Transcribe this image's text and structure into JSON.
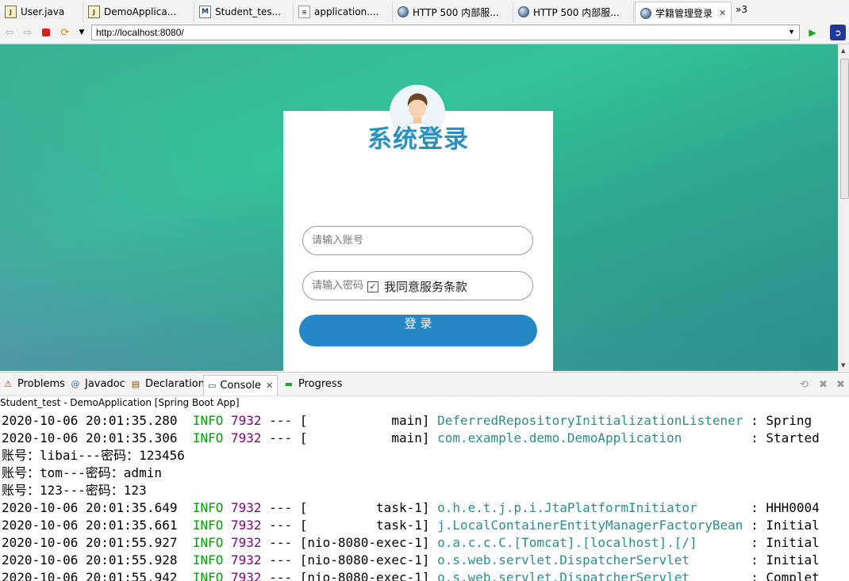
{
  "editor_tabs": [
    {
      "label": "User.java",
      "icon": "java-file-icon"
    },
    {
      "label": "DemoApplica...",
      "icon": "java-file-icon"
    },
    {
      "label": "Student_tes...",
      "icon": "maven-pom-icon"
    },
    {
      "label": "application....",
      "icon": "properties-file-icon"
    },
    {
      "label": "HTTP 500 内部服...",
      "icon": "globe-icon"
    },
    {
      "label": "HTTP 500 内部服...",
      "icon": "globe-icon"
    },
    {
      "label": "学籍管理登录",
      "icon": "globe-icon",
      "active": true
    }
  ],
  "tabs_overflow": "»3",
  "browser": {
    "url": "http://localhost:8080/"
  },
  "login": {
    "title": "系统登录",
    "username_placeholder": "请输入账号",
    "password_placeholder": "请输入密码",
    "agree_label": "我同意服务条款",
    "agree_checked": true,
    "login_button": "登 录"
  },
  "views": {
    "tabs": [
      "Problems",
      "Javadoc",
      "Declaration",
      "Console",
      "Progress"
    ],
    "active": "Console"
  },
  "console": {
    "header": "Student_test - DemoApplication [Spring Boot App]",
    "lines": [
      {
        "ts": "2020-10-06 20:01:35.280",
        "level": "INFO",
        "pid": "7932",
        "sep": "---",
        "thread": "[           main]",
        "logger": "DeferredRepositoryInitializationListener",
        "msg": ": Spring"
      },
      {
        "ts": "2020-10-06 20:01:35.306",
        "level": "INFO",
        "pid": "7932",
        "sep": "---",
        "thread": "[           main]",
        "logger": "com.example.demo.DemoApplication        ",
        "msg": ": Started"
      },
      {
        "text": "账号：libai---密码：123456"
      },
      {
        "text": "账号：tom---密码：admin"
      },
      {
        "text": "账号：123---密码：123"
      },
      {
        "ts": "2020-10-06 20:01:35.649",
        "level": "INFO",
        "pid": "7932",
        "sep": "---",
        "thread": "[         task-1]",
        "logger": "o.h.e.t.j.p.i.JtaPlatformInitiator      ",
        "msg": ": HHH0004"
      },
      {
        "ts": "2020-10-06 20:01:35.661",
        "level": "INFO",
        "pid": "7932",
        "sep": "---",
        "thread": "[         task-1]",
        "logger": "j.LocalContainerEntityManagerFactoryBean",
        "msg": ": Initial"
      },
      {
        "ts": "2020-10-06 20:01:55.927",
        "level": "INFO",
        "pid": "7932",
        "sep": "---",
        "thread": "[nio-8080-exec-1]",
        "logger": "o.a.c.c.C.[Tomcat].[localhost].[/]      ",
        "msg": ": Initial"
      },
      {
        "ts": "2020-10-06 20:01:55.928",
        "level": "INFO",
        "pid": "7932",
        "sep": "---",
        "thread": "[nio-8080-exec-1]",
        "logger": "o.s.web.servlet.DispatcherServlet       ",
        "msg": ": Initial"
      },
      {
        "ts": "2020-10-06 20:01:55.942",
        "level": "INFO",
        "pid": "7932",
        "sep": "---",
        "thread": "[nio-8080-exec-1]",
        "logger": "o.s.web.servlet.DispatcherServlet       ",
        "msg": ": Complet"
      }
    ]
  },
  "colors": {
    "page_bg": "#34c39a",
    "title": "#2b8fc0",
    "login_button": "#2687c6",
    "info": "#00a000",
    "pid": "#800080",
    "logger": "#2e8b8b"
  }
}
